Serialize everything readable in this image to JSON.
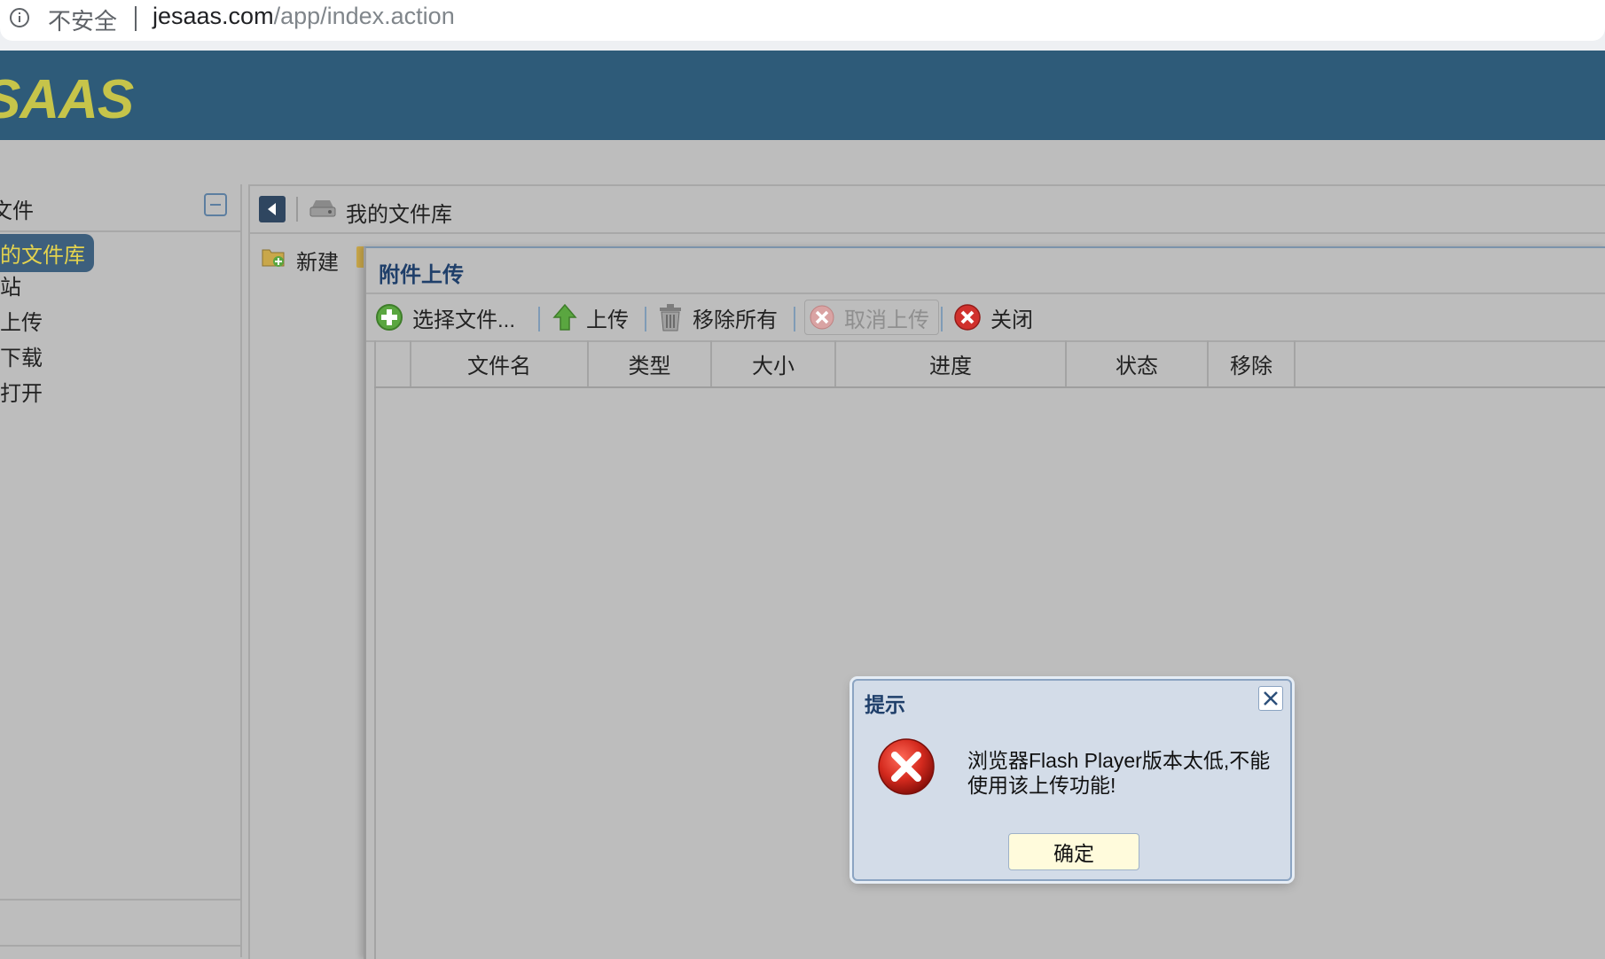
{
  "browser": {
    "security_label": "不安全",
    "url_host": "jesaas.com",
    "url_path": "/app/index.action"
  },
  "app": {
    "logo_text": "SAAS"
  },
  "left_panel": {
    "title": "文件",
    "items": [
      {
        "label": "的文件库",
        "selected": true
      },
      {
        "label": "站"
      },
      {
        "label": "上传"
      },
      {
        "label": "下载"
      },
      {
        "label": "打开"
      }
    ]
  },
  "main": {
    "breadcrumb_label": "我的文件库",
    "toolbar_new_label": "新建"
  },
  "upload_dialog": {
    "title": "附件上传",
    "toolbar": {
      "select_files": "选择文件...",
      "upload": "上传",
      "remove_all": "移除所有",
      "cancel_upload": "取消上传",
      "close": "关闭"
    },
    "columns": [
      "文件名",
      "类型",
      "大小",
      "进度",
      "状态",
      "移除"
    ]
  },
  "alert": {
    "title": "提示",
    "message": "浏览器Flash Player版本太低,不能使用该上传功能!",
    "ok_label": "确定"
  },
  "colors": {
    "header_bg": "#2e5b79",
    "logo": "#c6c44a",
    "selected_item_bg": "#3d5f7d",
    "selected_item_text": "#e4d34e",
    "dialog_title": "#1f3f6a"
  }
}
